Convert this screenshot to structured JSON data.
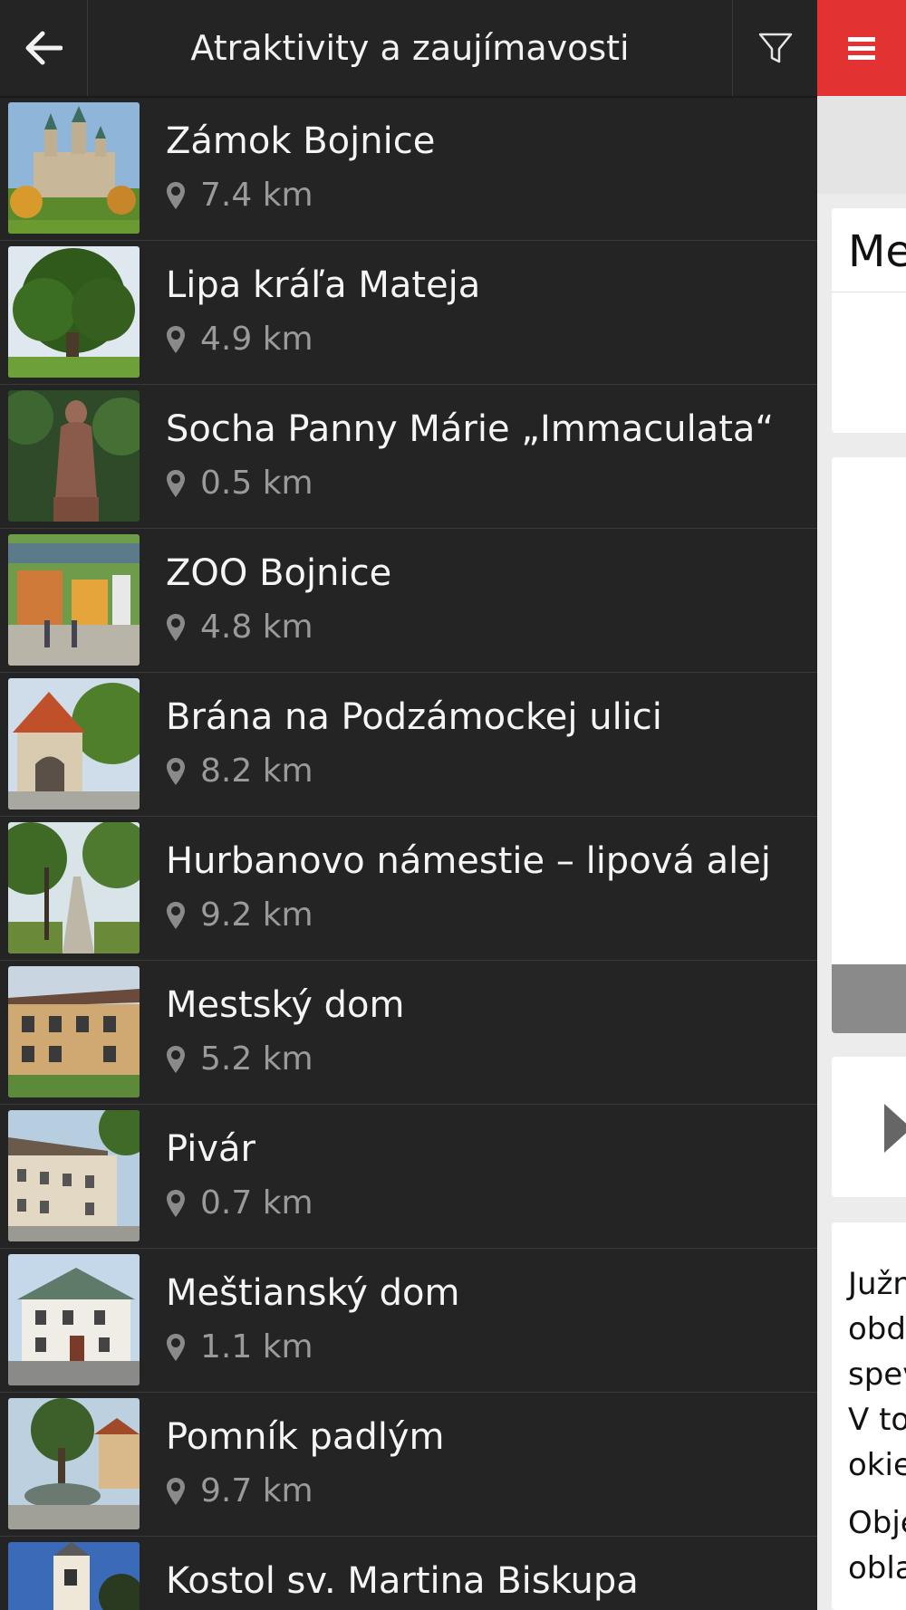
{
  "header": {
    "title": "Atraktivity a zaujímavosti",
    "back_icon": "arrow-left-icon",
    "filter_icon": "filter-icon",
    "menu_icon": "hamburger-menu-icon"
  },
  "colors": {
    "panel_bg": "#242424",
    "accent_red": "#e23232",
    "distance_grey": "#9a9a9a"
  },
  "places": [
    {
      "name": "Zámok Bojnice",
      "distance": "7.4 km"
    },
    {
      "name": "Lipa kráľa Mateja",
      "distance": "4.9 km"
    },
    {
      "name": "Socha Panny Márie „Immaculata“",
      "distance": "0.5 km"
    },
    {
      "name": "ZOO Bojnice",
      "distance": "4.8 km"
    },
    {
      "name": "Brána na Podzámockej ulici",
      "distance": "8.2 km"
    },
    {
      "name": "Hurbanovo námestie – lipová alej",
      "distance": "9.2 km"
    },
    {
      "name": "Mestský dom",
      "distance": "5.2 km"
    },
    {
      "name": "Pivár",
      "distance": "0.7 km"
    },
    {
      "name": "Meštianský dom",
      "distance": "1.1 km"
    },
    {
      "name": "Pomník padlým",
      "distance": "9.7 km"
    },
    {
      "name": "Kostol sv. Martina Biskupa",
      "distance": ""
    }
  ],
  "background_page": {
    "card_title": "Me",
    "text_lines": [
      "Južn",
      "obd",
      "spev",
      "V to",
      "okie"
    ],
    "text_lines_2": [
      "Obje",
      "obla"
    ]
  }
}
